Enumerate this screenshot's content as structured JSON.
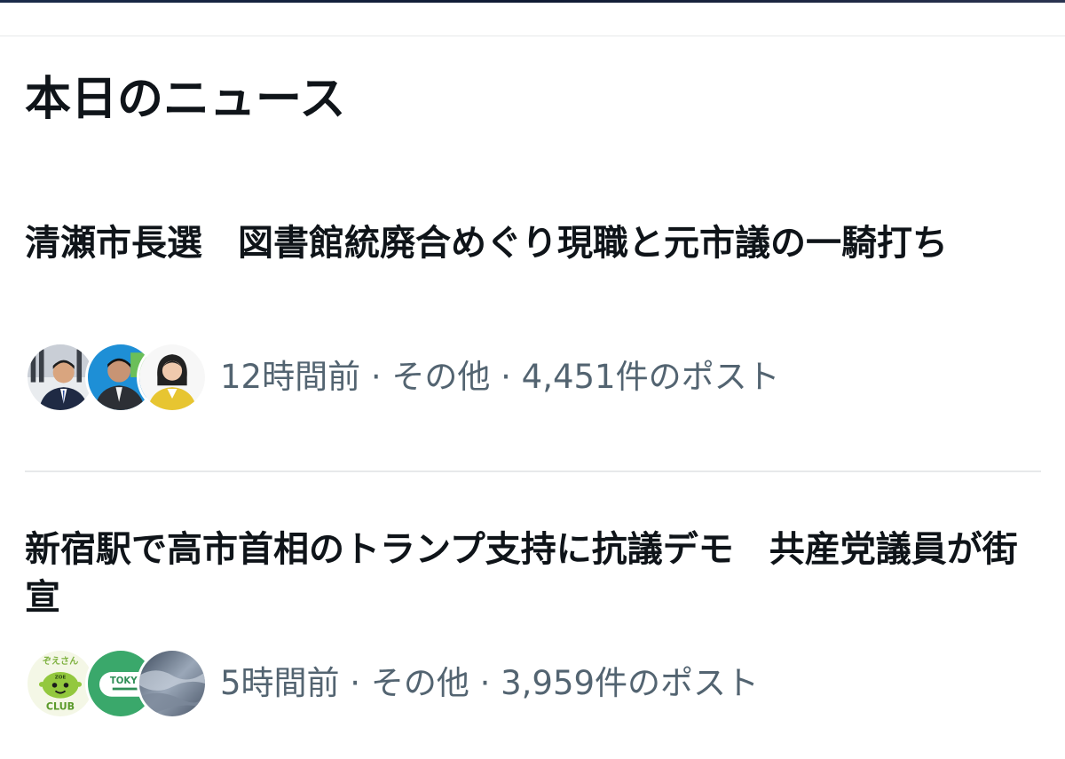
{
  "section": {
    "title": "本日のニュース"
  },
  "news": [
    {
      "headline": "清瀬市長選　図書館統廃合めぐり現職と元市議の一騎打ち",
      "meta": "12時間前 · その他 · 4,451件のポスト",
      "avatars": [
        "person-avatar",
        "person-avatar",
        "person-avatar"
      ]
    },
    {
      "headline": "新宿駅で高市首相のトランプ支持に抗議デモ　共産党議員が街宣",
      "meta": "5時間前 · その他 · 3,959件のポスト",
      "avatars": [
        "zoe-club-logo",
        "tokyo-logo",
        "sky-photo"
      ],
      "logo_texts": {
        "zoe_top": "ぞえさん",
        "zoe_mid": "ZOE",
        "zoe_bottom": "CLUB",
        "tokyo": "TOKYO"
      }
    }
  ],
  "colors": {
    "text_primary": "#0f1419",
    "text_secondary": "#536471",
    "divider": "#e7e9ea"
  }
}
